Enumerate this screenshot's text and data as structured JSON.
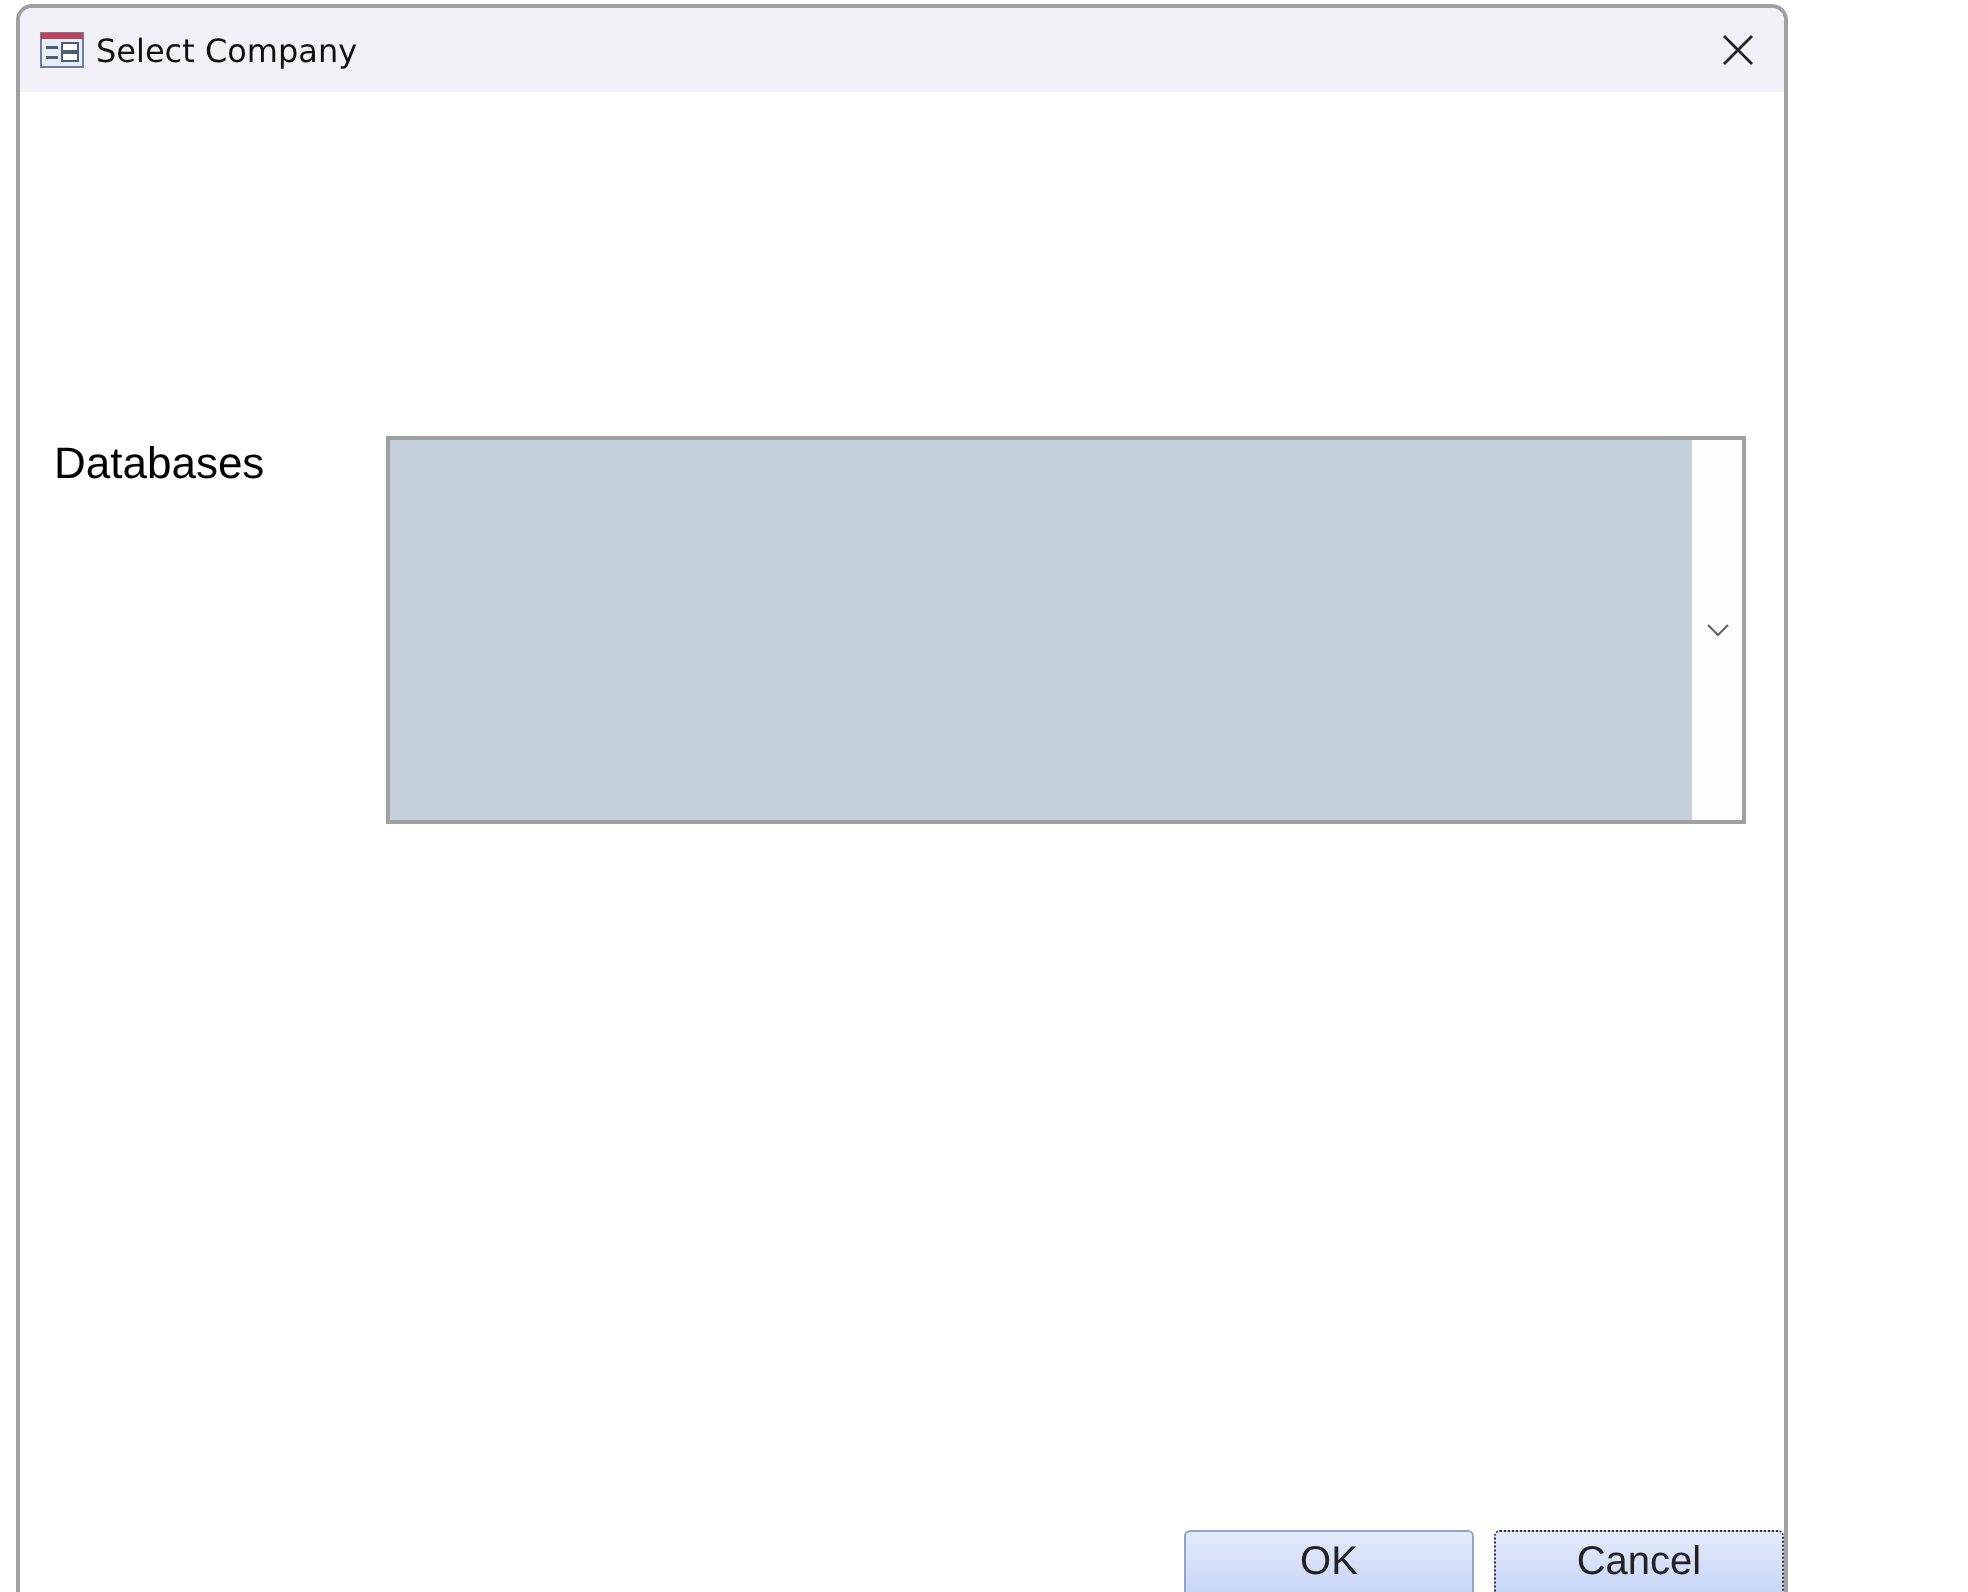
{
  "window": {
    "title": "Select Company"
  },
  "databases": {
    "label": "Databases"
  },
  "buttons": [
    {
      "label": "OK",
      "focused": false
    },
    {
      "label": "Cancel",
      "focused": true
    }
  ]
}
